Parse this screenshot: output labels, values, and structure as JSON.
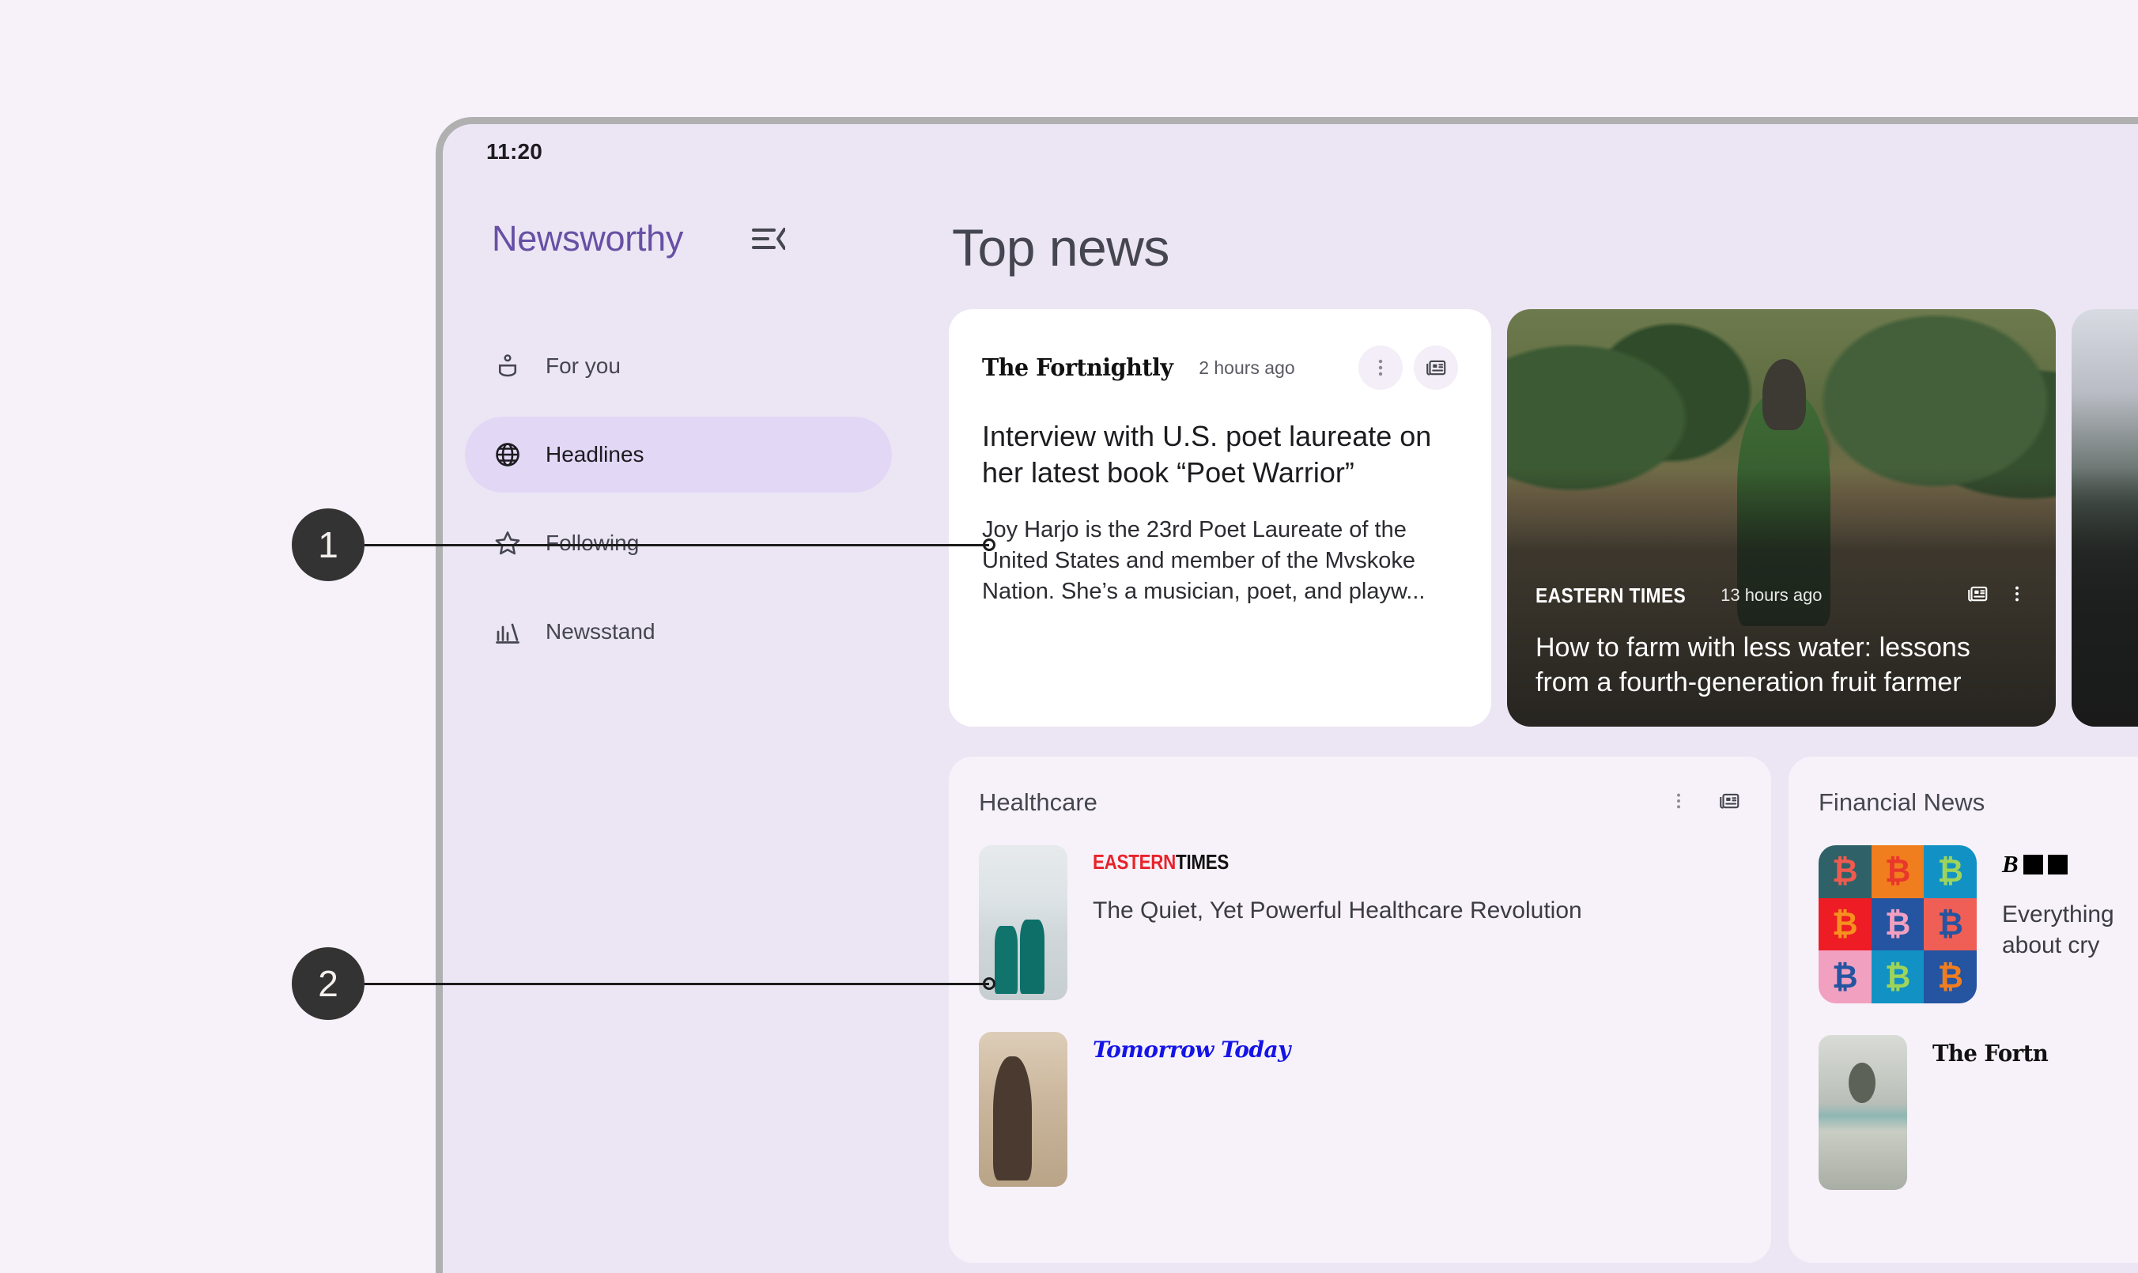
{
  "status_bar": {
    "time": "11:20"
  },
  "sidebar": {
    "brand": "Newsworthy",
    "menu_icon": "menu-open-icon",
    "items": [
      {
        "label": "For you",
        "icon": "person-box-icon",
        "active": false
      },
      {
        "label": "Headlines",
        "icon": "globe-icon",
        "active": true
      },
      {
        "label": "Following",
        "icon": "star-outline-icon",
        "active": false
      },
      {
        "label": "Newsstand",
        "icon": "bar-chart-icon",
        "active": false
      }
    ]
  },
  "main": {
    "page_title": "Top news",
    "top_news": [
      {
        "type": "text-card",
        "source": "The Fortnightly",
        "time": "2 hours ago",
        "headline": "Interview with U.S. poet laureate on her latest book “Poet Warrior”",
        "summary": "Joy Harjo is the 23rd Poet Laureate of the United States and member of the Mvskoke Nation. She’s a musician, poet, and playw...",
        "actions": [
          "more-options-icon",
          "full-coverage-icon"
        ]
      },
      {
        "type": "image-card",
        "source": "EASTERN TIMES",
        "time": "13 hours ago",
        "headline": "How to farm with less water: lessons from a fourth-generation fruit farmer",
        "actions": [
          "full-coverage-icon",
          "more-options-icon"
        ]
      },
      {
        "type": "image-card",
        "source": "",
        "time": "",
        "headline": "",
        "actions": []
      }
    ],
    "sections": [
      {
        "title": "Healthcare",
        "actions": [
          "more-options-icon",
          "full-coverage-icon"
        ],
        "articles": [
          {
            "source_logo": "eastern-times",
            "source_parts": {
              "red": "EASTERN",
              "black": "TIMES"
            },
            "headline": "The Quiet, Yet Powerful Healthcare Revolution",
            "thumb": "hospital-corridor-photo"
          },
          {
            "source_logo": "tomorrow-today",
            "source_text": "Tomorrow Today",
            "headline": "",
            "thumb": "potter-workshop-photo"
          }
        ]
      },
      {
        "title": "Financial News",
        "actions": [],
        "articles": [
          {
            "source_logo": "bloomberg-redacted",
            "source_text": "B",
            "headline": "Everything about cry",
            "thumb": "bitcoin-pop-art-tile"
          },
          {
            "source_logo": "the-fortnightly",
            "source_text": "The Fortn",
            "headline": "",
            "thumb": "hundred-dollar-bill-photo"
          }
        ]
      }
    ]
  },
  "annotations": [
    {
      "number": "1",
      "target": "article-source-row"
    },
    {
      "number": "2",
      "target": "healthcare-section-list"
    }
  ],
  "colors": {
    "page_background": "#f7f2f9",
    "panel_background": "#ece6f4",
    "card_background": "#ffffff",
    "section_card_background": "#f7f2fa",
    "brand_purple": "#6750a4",
    "nav_active_pill": "#e3d7f6",
    "device_bezel": "#b0b0b0",
    "callout_badge": "#333333",
    "eastern_times_red": "#e8232a",
    "tomorrow_today_blue": "#1414e6"
  },
  "bitcoin_tile_colors": [
    {
      "bg": "#2e6268",
      "fg": "#f05a4f"
    },
    {
      "bg": "#f07d1e",
      "fg": "#e8372b"
    },
    {
      "bg": "#1292c4",
      "fg": "#9ed45a"
    },
    {
      "bg": "#ee1c25",
      "fg": "#f5911e"
    },
    {
      "bg": "#2554a0",
      "fg": "#f2a0c0"
    },
    {
      "bg": "#ef5f55",
      "fg": "#2554a0"
    },
    {
      "bg": "#f2a0c0",
      "fg": "#2554a0"
    },
    {
      "bg": "#1292c4",
      "fg": "#9ed45a"
    },
    {
      "bg": "#2554a0",
      "fg": "#f07d1e"
    }
  ]
}
